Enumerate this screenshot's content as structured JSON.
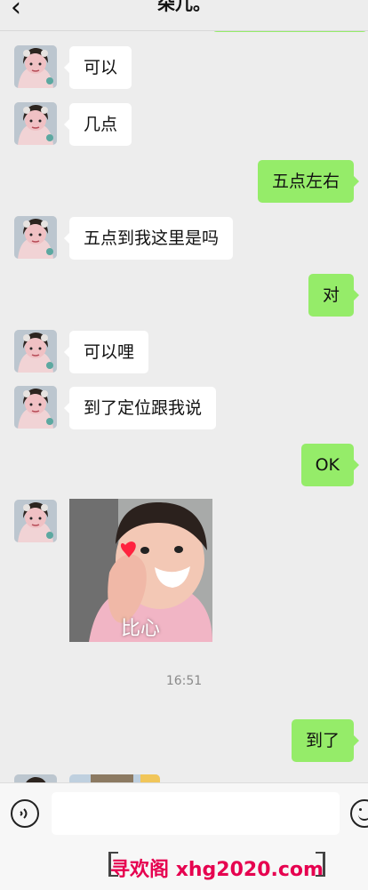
{
  "header": {
    "back_icon": "chevron-left-icon",
    "title": "朵儿。"
  },
  "messages": [
    {
      "side": "left",
      "text": "可以"
    },
    {
      "side": "left",
      "text": "几点"
    },
    {
      "side": "right",
      "text": "五点左右"
    },
    {
      "side": "left",
      "text": "五点到我这里是吗"
    },
    {
      "side": "right",
      "text": "对"
    },
    {
      "side": "left",
      "text": "可以哩"
    },
    {
      "side": "left",
      "text": "到了定位跟我说"
    },
    {
      "side": "right",
      "text": "OK"
    },
    {
      "side": "left",
      "sticker_caption": "比心"
    },
    {
      "timestamp": "16:51"
    },
    {
      "side": "right",
      "text": "到了"
    }
  ],
  "composer": {
    "voice_icon": "voice-icon",
    "emoji_icon": "emoji-icon"
  },
  "watermark": {
    "text": "寻欢阁 xhg2020.com"
  },
  "colors": {
    "background": "#ededed",
    "sent_bubble": "#95ec69",
    "received_bubble": "#ffffff",
    "watermark": "#e6004f"
  }
}
